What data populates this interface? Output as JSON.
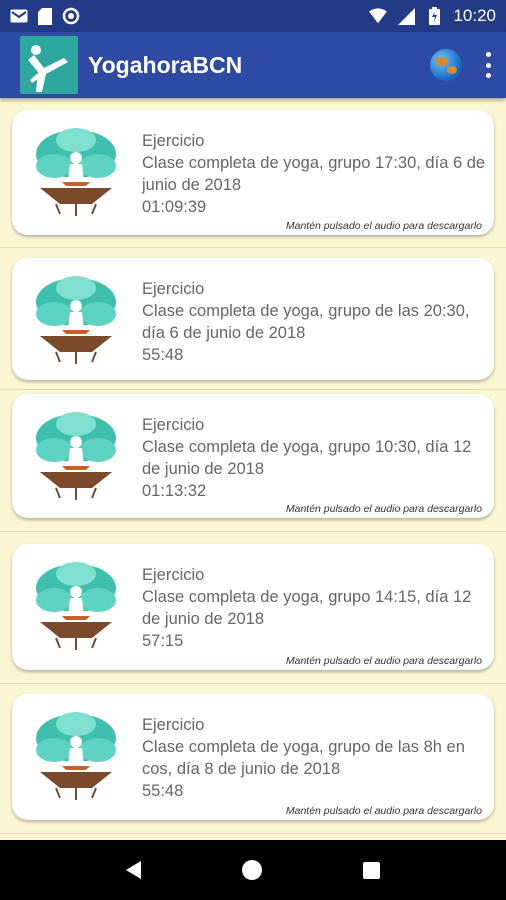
{
  "status_bar": {
    "time": "10:20",
    "icons": [
      "gmail-icon",
      "sd-card-icon",
      "sync-icon",
      "wifi-icon",
      "signal-icon",
      "battery-charging-icon"
    ]
  },
  "app_bar": {
    "title": "YogahoraBCN",
    "logo_icon": "yoga-pose-logo-icon",
    "actions": [
      "globe-icon",
      "more-vert-icon"
    ]
  },
  "colors": {
    "status_bar": "#233a86",
    "app_bar": "#2f4aa3",
    "background": "#fbf6d3",
    "card": "#ffffff",
    "tree_leaves": "#3fbfae",
    "tree_roots": "#7a4a2a"
  },
  "items": [
    {
      "label": "Ejercicio",
      "title": "Clase completa de yoga, grupo 17:30, día 6 de junio de 2018",
      "duration": "01:09:39",
      "hint": "Mantén pulsado el audio para descargarlo"
    },
    {
      "label": "Ejercicio",
      "title": "Clase completa de yoga, grupo de las 20:30, día 6 de junio de 2018",
      "duration": "55:48",
      "hint": ""
    },
    {
      "label": "Ejercicio",
      "title": "Clase completa de yoga, grupo 10:30, día 12 de junio de 2018",
      "duration": "01:13:32",
      "hint": "Mantén pulsado el audio para descargarlo"
    },
    {
      "label": "Ejercicio",
      "title": "Clase completa de yoga, grupo 14:15, día 12 de junio de 2018",
      "duration": "57:15",
      "hint": "Mantén pulsado el audio para descargarlo"
    },
    {
      "label": "Ejercicio",
      "title": "Clase completa de yoga, grupo de las 8h en cos, día 8 de junio de 2018",
      "duration": "55:48",
      "hint": "Mantén pulsado el audio para descargarlo"
    }
  ],
  "nav_bar": {
    "buttons": [
      "back-icon",
      "home-icon",
      "recents-icon"
    ]
  }
}
